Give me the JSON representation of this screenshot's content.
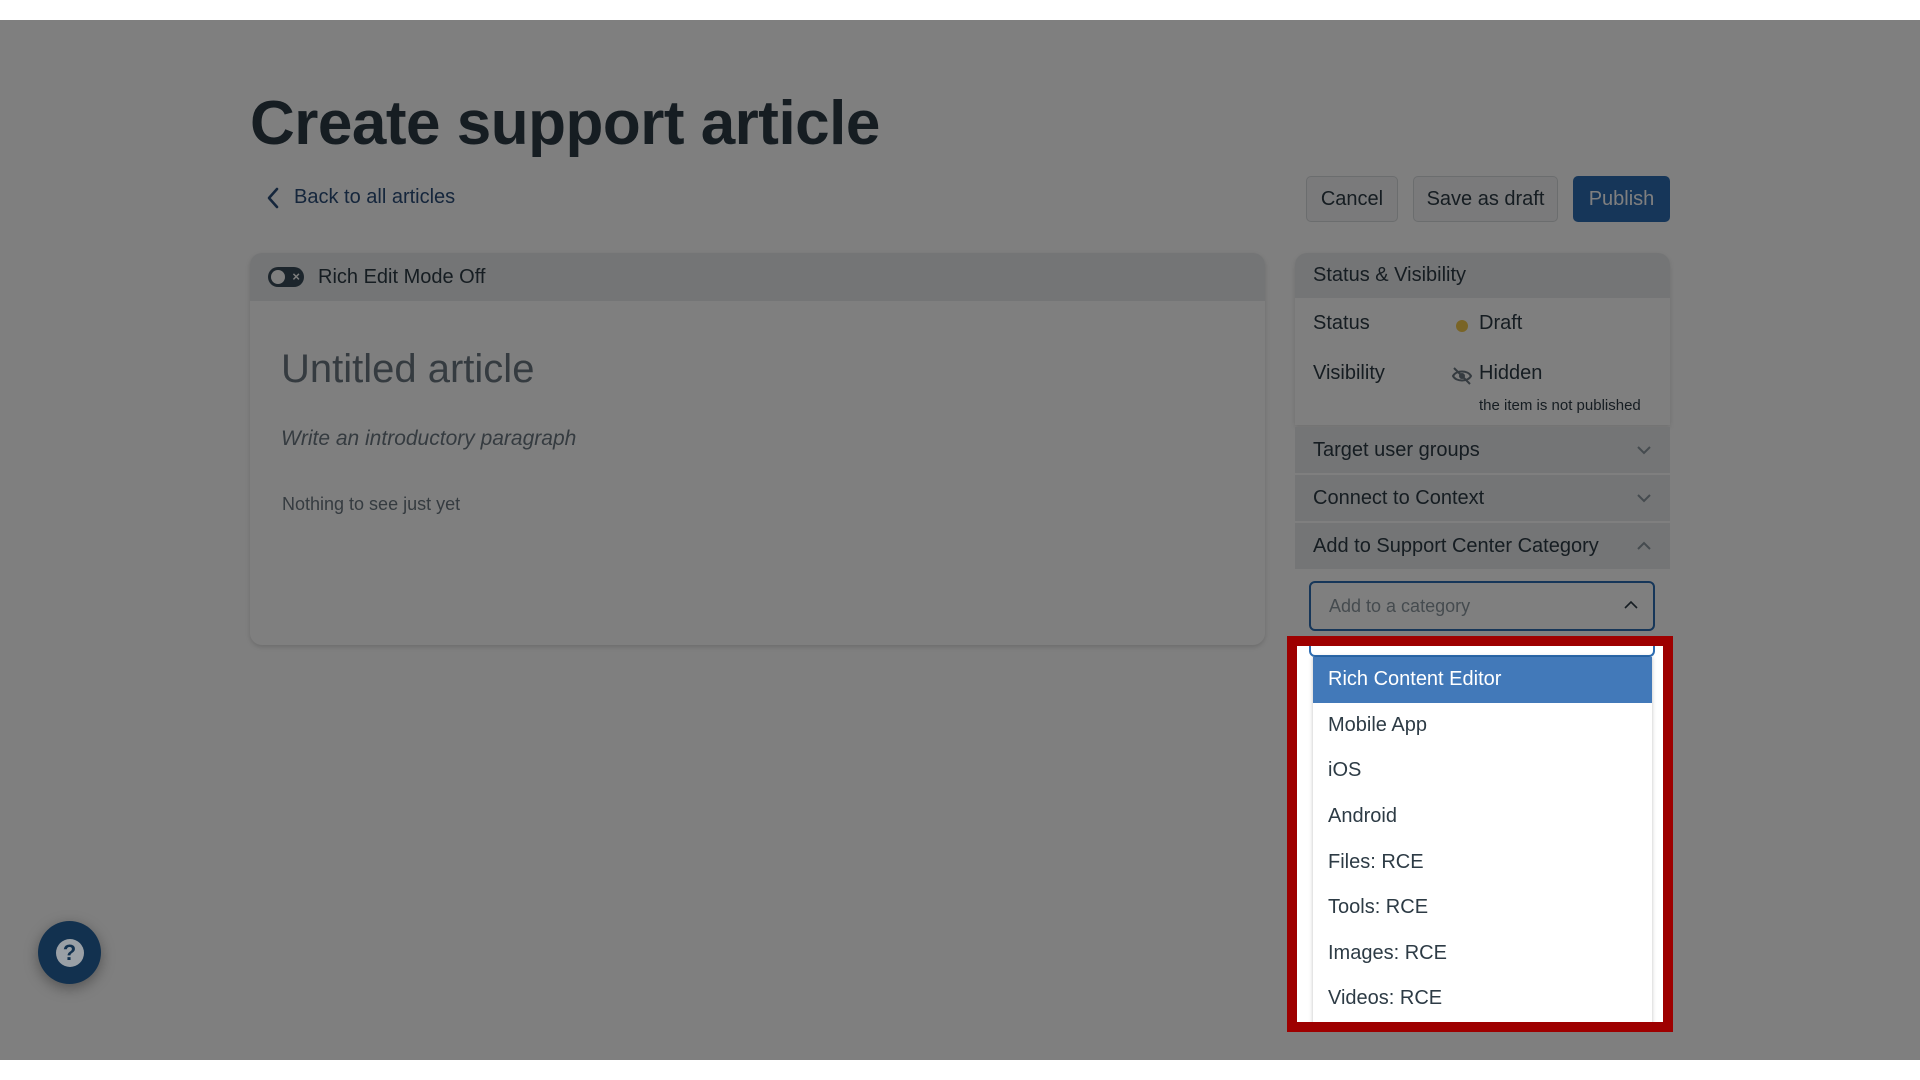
{
  "page": {
    "title": "Create support article",
    "back_link": "Back to all articles"
  },
  "toolbar": {
    "cancel_label": "Cancel",
    "save_draft_label": "Save as draft",
    "publish_label": "Publish"
  },
  "editor": {
    "mode_label": "Rich Edit Mode Off",
    "title_placeholder": "Untitled article",
    "intro_placeholder": "Write an introductory paragraph",
    "body_text": "Nothing to see just yet"
  },
  "sidebar": {
    "status_visibility": {
      "heading": "Status & Visibility",
      "status_label": "Status",
      "status_value": "Draft",
      "status_color": "#f2c94c",
      "visibility_label": "Visibility",
      "visibility_value": "Hidden",
      "visibility_note": "the item is not published"
    },
    "sections": [
      {
        "label": "Target user groups",
        "expanded": false
      },
      {
        "label": "Connect to Context",
        "expanded": false
      },
      {
        "label": "Add to Support Center Category",
        "expanded": true
      }
    ],
    "category": {
      "placeholder": "Add to a category",
      "options": [
        "Rich Content Editor",
        "Mobile App",
        "iOS",
        "Android",
        "Files: RCE",
        "Tools: RCE",
        "Images: RCE",
        "Videos: RCE"
      ],
      "highlighted_index": 0
    }
  },
  "help": {
    "icon": "question-circle-icon"
  },
  "colors": {
    "primary": "#2d6db3",
    "option_highlight": "#4279b9",
    "callout_border": "#9e0000",
    "help_button": "#12314f"
  }
}
